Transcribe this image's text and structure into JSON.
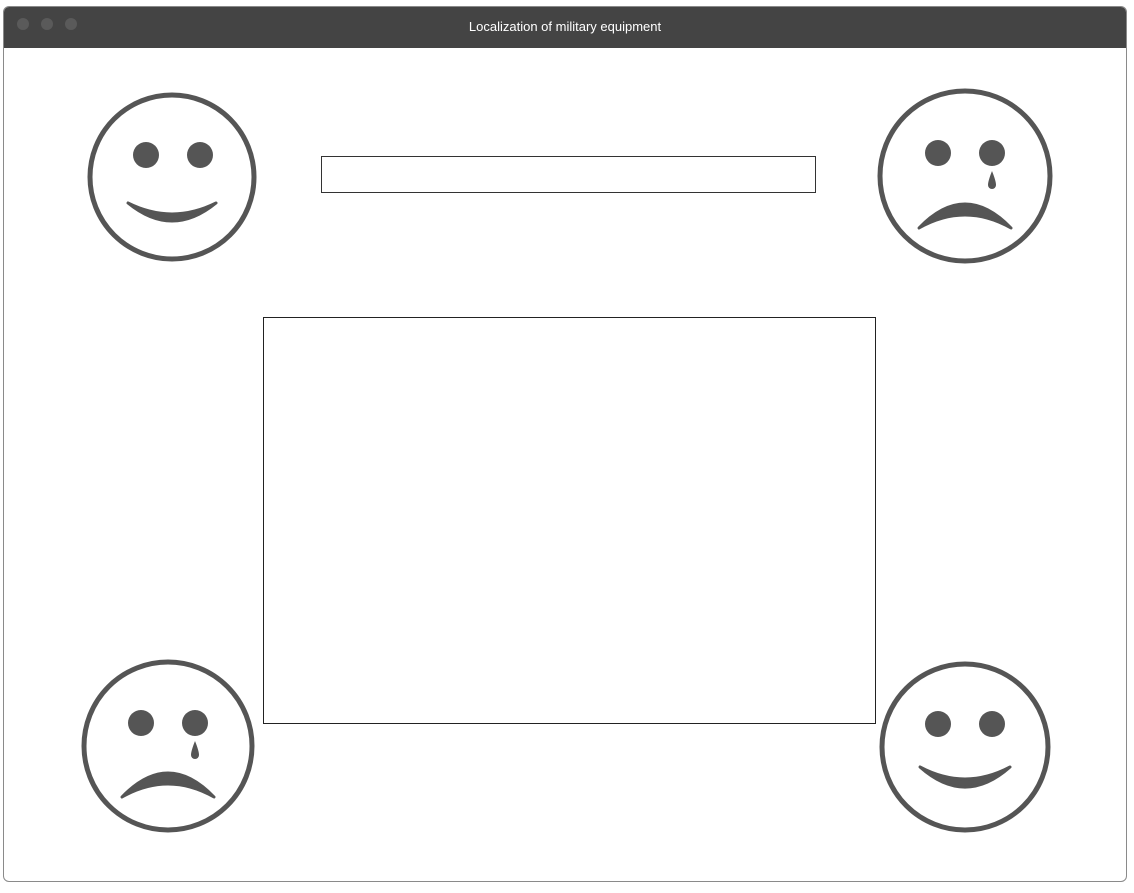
{
  "window": {
    "title": "Localization of military equipment"
  },
  "icons": {
    "top_left": "happy-face-icon",
    "top_right": "crying-face-icon",
    "bottom_left": "crying-face-icon",
    "bottom_right": "happy-face-icon"
  },
  "colors": {
    "titlebar": "#444444",
    "icon": "#555555",
    "border": "#222222"
  },
  "input": {
    "value": "",
    "placeholder": ""
  }
}
